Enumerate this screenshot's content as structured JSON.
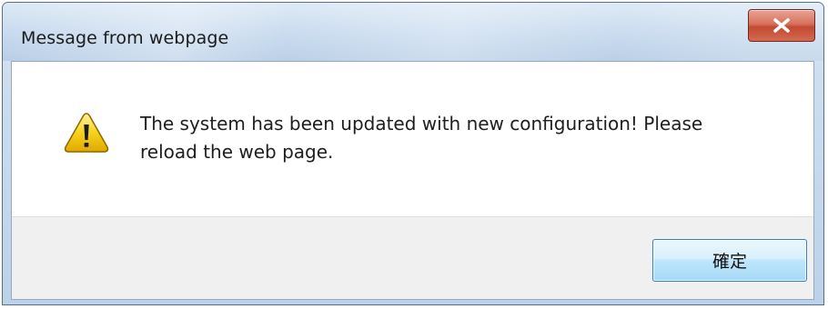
{
  "dialog": {
    "title": "Message from webpage",
    "close_symbol": "x",
    "icon": "warning-icon",
    "message_line1": "The system has been updated with new configuration! Please",
    "message_line2": "reload the web page.",
    "ok_label": "確定"
  },
  "colors": {
    "titlebar": "#c6d9ee",
    "close_button": "#c24a33",
    "warning_yellow": "#f5c400",
    "ok_button": "#bee6fd",
    "button_area": "#f0f0f0"
  }
}
